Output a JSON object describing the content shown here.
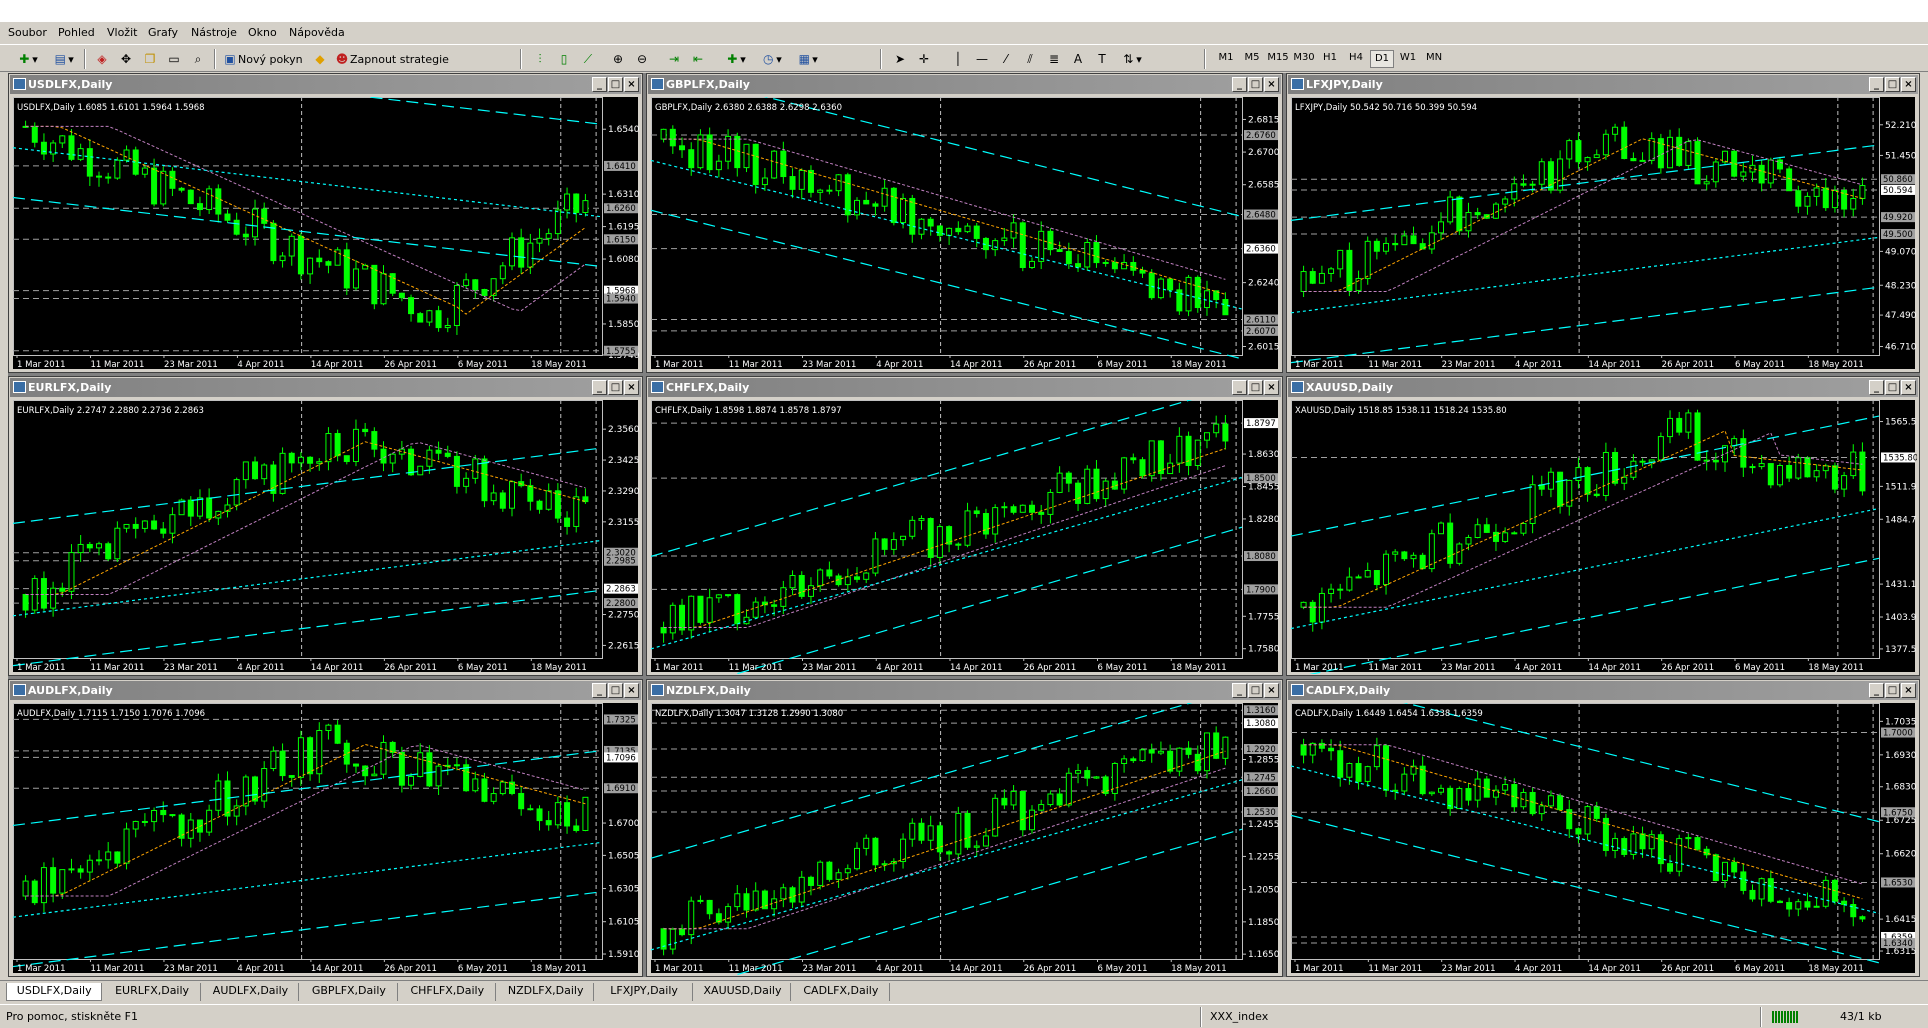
{
  "menu": [
    "Soubor",
    "Pohled",
    "Vložit",
    "Grafy",
    "Nástroje",
    "Okno",
    "Nápověda"
  ],
  "toolbar": {
    "new_order": "Nový pokyn",
    "enable_strategies": "Zapnout strategie"
  },
  "timeframes": [
    "M1",
    "M5",
    "M15",
    "M30",
    "H1",
    "H4",
    "D1",
    "W1",
    "MN"
  ],
  "active_timeframe": "D1",
  "xlabels": [
    "1 Mar 2011",
    "11 Mar 2011",
    "23 Mar 2011",
    "4 Apr 2011",
    "14 Apr 2011",
    "26 Apr 2011",
    "6 May 2011",
    "18 May 2011"
  ],
  "charts": [
    {
      "title": "USDLFX,Daily",
      "info": "USDLFX,Daily  1.6085 1.6101 1.5964 1.5968",
      "ymin": 1.574,
      "ymax": 1.664,
      "trend": "down-v",
      "bull": false,
      "ticks": [
        "1.6540",
        "1.6310",
        "1.6195",
        "1.6080",
        "1.5850",
        "1.5740"
      ],
      "boxes": [
        {
          "t": "1.6410",
          "v": 1.641
        },
        {
          "t": "1.6260",
          "v": 1.626
        },
        {
          "t": "1.6150",
          "v": 1.615
        },
        {
          "t": "1.5968",
          "v": 1.5968
        },
        {
          "t": "1.5940",
          "v": 1.594
        },
        {
          "t": "1.5755",
          "v": 1.5755
        }
      ]
    },
    {
      "title": "GBPLFX,Daily",
      "info": "GBPLFX,Daily  2.6380 2.6388 2.6298 2.6360",
      "ymin": 2.5985,
      "ymax": 2.688,
      "trend": "down",
      "bull": true,
      "ticks": [
        "2.6815",
        "2.6700",
        "2.6585",
        "2.6240",
        "2.6015"
      ],
      "boxes": [
        {
          "t": "2.6760",
          "v": 2.676
        },
        {
          "t": "2.6480",
          "v": 2.648
        },
        {
          "t": "2.6360",
          "v": 2.636
        },
        {
          "t": "2.6110",
          "v": 2.611
        },
        {
          "t": "2.6070",
          "v": 2.607
        }
      ]
    },
    {
      "title": "LFXJPY,Daily",
      "info": "LFXJPY,Daily  50.542 50.716 50.399 50.594",
      "ymin": 46.5,
      "ymax": 52.8,
      "trend": "up-down",
      "bull": true,
      "ticks": [
        "52.210",
        "51.450",
        "49.070",
        "48.230",
        "47.490",
        "46.710"
      ],
      "boxes": [
        {
          "t": "50.860",
          "v": 50.86
        },
        {
          "t": "50.594",
          "v": 50.594
        },
        {
          "t": "49.920",
          "v": 49.92
        },
        {
          "t": "49.500",
          "v": 49.5
        }
      ]
    },
    {
      "title": "EURLFX,Daily",
      "info": "EURLFX,Daily  2.2747 2.2880 2.2736 2.2863",
      "ymin": 2.256,
      "ymax": 2.367,
      "trend": "up-down",
      "bull": true,
      "ticks": [
        "2.3560",
        "2.3425",
        "2.3290",
        "2.3155",
        "2.2750",
        "2.2615"
      ],
      "boxes": [
        {
          "t": "2.3020",
          "v": 2.302
        },
        {
          "t": "2.2985",
          "v": 2.2985
        },
        {
          "t": "2.2863",
          "v": 2.2863
        },
        {
          "t": "2.2800",
          "v": 2.28
        }
      ]
    },
    {
      "title": "CHFLFX,Daily",
      "info": "CHFLFX,Daily  1.8598 1.8874 1.8578 1.8797",
      "ymin": 1.753,
      "ymax": 1.89,
      "trend": "up",
      "bull": true,
      "ticks": [
        "1.8630",
        "1.8455",
        "1.8280",
        "1.7755",
        "1.7580"
      ],
      "boxes": [
        {
          "t": "1.8797",
          "v": 1.8797
        },
        {
          "t": "1.8500",
          "v": 1.85
        },
        {
          "t": "1.8080",
          "v": 1.808
        },
        {
          "t": "1.7900",
          "v": 1.79
        }
      ]
    },
    {
      "title": "XAUUSD,Daily",
      "info": "XAUUSD,Daily  1518.85 1538.11 1518.24 1535.80",
      "ymin": 1370.0,
      "ymax": 1580.0,
      "trend": "up-v",
      "bull": true,
      "ticks": [
        "1565.50",
        "1511.90",
        "1484.70",
        "1431.10",
        "1403.90",
        "1377.50"
      ],
      "boxes": [
        {
          "t": "1535.80",
          "v": 1535.8
        }
      ]
    },
    {
      "title": "AUDLFX,Daily",
      "info": "AUDLFX,Daily  1.7115 1.7150 1.7076 1.7096",
      "ymin": 1.588,
      "ymax": 1.74,
      "trend": "up-down",
      "bull": true,
      "ticks": [
        "1.6700",
        "1.6505",
        "1.6305",
        "1.6105",
        "1.5910"
      ],
      "boxes": [
        {
          "t": "1.7325",
          "v": 1.7325
        },
        {
          "t": "1.7135",
          "v": 1.7135
        },
        {
          "t": "1.7096",
          "v": 1.7096
        },
        {
          "t": "1.6910",
          "v": 1.691
        }
      ]
    },
    {
      "title": "NZDLFX,Daily",
      "info": "NZDLFX,Daily  1.3047 1.3128 1.2990 1.3080",
      "ymin": 1.162,
      "ymax": 1.318,
      "trend": "up",
      "bull": true,
      "ticks": [
        "1.2855",
        "1.2455",
        "1.2255",
        "1.2050",
        "1.1850",
        "1.1650"
      ],
      "boxes": [
        {
          "t": "1.3160",
          "v": 1.316
        },
        {
          "t": "1.3080",
          "v": 1.308
        },
        {
          "t": "1.2920",
          "v": 1.292
        },
        {
          "t": "1.2745",
          "v": 1.2745
        },
        {
          "t": "1.2660",
          "v": 1.266
        },
        {
          "t": "1.2530",
          "v": 1.253
        }
      ]
    },
    {
      "title": "CADLFX,Daily",
      "info": "CADLFX,Daily  1.6449 1.6454 1.6338 1.6359",
      "ymin": 1.629,
      "ymax": 1.708,
      "trend": "down",
      "bull": false,
      "ticks": [
        "1.7035",
        "1.6930",
        "1.6830",
        "1.6725",
        "1.6620",
        "1.6415",
        "1.6315"
      ],
      "boxes": [
        {
          "t": "1.7000",
          "v": 1.7
        },
        {
          "t": "1.6750",
          "v": 1.675
        },
        {
          "t": "1.6530",
          "v": 1.653
        },
        {
          "t": "1.6359",
          "v": 1.6359
        },
        {
          "t": "1.6340",
          "v": 1.634
        }
      ]
    }
  ],
  "tabs": [
    "USDLFX,Daily",
    "EURLFX,Daily",
    "AUDLFX,Daily",
    "GBPLFX,Daily",
    "CHFLFX,Daily",
    "NZDLFX,Daily",
    "LFXJPY,Daily",
    "XAUUSD,Daily",
    "CADLFX,Daily"
  ],
  "status": {
    "help": "Pro pomoc, stiskněte F1",
    "profile": "XXX_index",
    "traffic": "43/1 kb"
  },
  "colors": {
    "bg": "#000000",
    "candle": "#00ff00",
    "grid": "#c0c0c0",
    "channel": "#00ffff",
    "ma1": "#ffa500",
    "ma2": "#c080c0"
  }
}
